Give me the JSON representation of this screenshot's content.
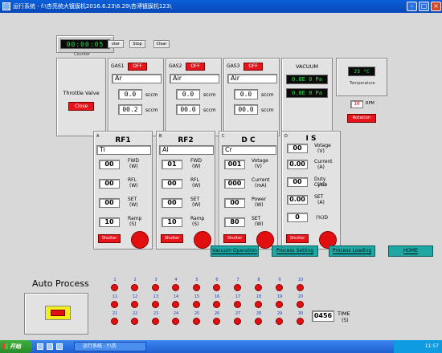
{
  "window": {
    "title": "运行系统 - f:\\杏亮统大镀膜机2016.6.23\\6.29\\杏溥镀膜机123\\"
  },
  "counter": {
    "digits": [
      "00",
      "00",
      "05"
    ],
    "label": "Counter",
    "buttons": [
      "star",
      "Stop",
      "Clear"
    ]
  },
  "throttle": {
    "label": "Throttle Valve",
    "button": "Close"
  },
  "gas": [
    {
      "name": "GAS1",
      "state": "OFF",
      "gas": "Ar",
      "setpoint": "0.0",
      "actual": "00.2",
      "unit": "sccm"
    },
    {
      "name": "GAS2",
      "state": "OFF",
      "gas": "Air",
      "setpoint": "0.0",
      "actual": "00.0",
      "unit": "sccm"
    },
    {
      "name": "GAS3",
      "state": "OFF",
      "gas": "Air",
      "setpoint": "0.0",
      "actual": "00.0",
      "unit": "sccm"
    }
  ],
  "vacuum": {
    "title": "VACUUM",
    "readings": [
      "0.0E 0 Pa",
      "0.0E 0 Pa"
    ]
  },
  "temperature": {
    "value": "23 °C",
    "label": "Temperature",
    "rpm_value": "10",
    "rpm_unit": "RPM",
    "rotation_button": "Rotation"
  },
  "sources": [
    {
      "letter": "A",
      "title": "RF1",
      "material": "Ti",
      "rows": [
        {
          "value": "00",
          "label": "FWD",
          "unit": "(W)"
        },
        {
          "value": "00",
          "label": "RFL",
          "unit": "(W)"
        },
        {
          "value": "00",
          "label": "SET",
          "unit": "(W)"
        },
        {
          "value": "10",
          "label": "Ramp",
          "unit": "(S)"
        }
      ],
      "shutter": "Shutter"
    },
    {
      "letter": "B",
      "title": "RF2",
      "material": "Al",
      "rows": [
        {
          "value": "01",
          "label": "FWD",
          "unit": "(W)"
        },
        {
          "value": "00",
          "label": "RFL",
          "unit": "(W)"
        },
        {
          "value": "00",
          "label": "SET",
          "unit": "(W)"
        },
        {
          "value": "10",
          "label": "Ramp",
          "unit": "(S)"
        }
      ],
      "shutter": "Shutter"
    },
    {
      "letter": "C",
      "title": "D C",
      "material": "Cr",
      "rows": [
        {
          "value": "001",
          "label": "Votage",
          "unit": "(V)"
        },
        {
          "value": "000",
          "label": "Current",
          "unit": "(mA)"
        },
        {
          "value": "00",
          "label": "Power",
          "unit": "(W)"
        },
        {
          "value": "80",
          "label": "SET",
          "unit": "(W)"
        }
      ],
      "shutter": "Shutter"
    },
    {
      "letter": "D",
      "title": "I S",
      "material": "",
      "rows": [
        {
          "value": "00",
          "label": "Votage",
          "unit": "(V)"
        },
        {
          "value": "0.00",
          "label": "Current",
          "unit": "(A)"
        },
        {
          "value": "00",
          "label": "Duty Cycle",
          "unit": "(%)"
        },
        {
          "value": "0.00",
          "label": "SET",
          "unit": "(A)"
        },
        {
          "value": "0",
          "label": "(%)D",
          "unit": ""
        }
      ],
      "shutter": "Shutter"
    }
  ],
  "nav": {
    "buttons": [
      "Vacuum Operation",
      "Process Setting",
      "Process Loading",
      "HOME"
    ]
  },
  "auto_process": {
    "title": "Auto Process",
    "steps": [
      "1",
      "2",
      "3",
      "4",
      "5",
      "6",
      "7",
      "8",
      "9",
      "10",
      "11",
      "12",
      "13",
      "14",
      "15",
      "16",
      "17",
      "18",
      "19",
      "20",
      "21",
      "22",
      "23",
      "24",
      "25",
      "26",
      "27",
      "28",
      "29",
      "30"
    ],
    "time_value": "0456",
    "time_label": "TIME",
    "time_unit": "(S)"
  },
  "taskbar": {
    "start": "开始",
    "task": "运行系统 - f:\\杏",
    "clock": "11:57"
  },
  "colors": {
    "title_blue": "#0a5fd8",
    "alarm_red": "#e10f10",
    "lcd_green": "#27e24a",
    "teal": "#1fa7a3",
    "warn_yellow": "#f2ee1c"
  }
}
